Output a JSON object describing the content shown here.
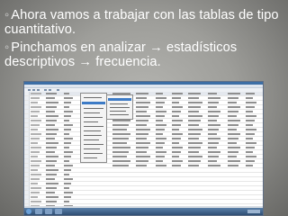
{
  "slide": {
    "bullets": [
      {
        "marker": "◦",
        "text": "Ahora vamos a trabajar con las tablas de tipo cuantitativo."
      },
      {
        "marker": "◦",
        "text": "Pinchamos en analizar → estadísticos descriptivos → frecuencia."
      }
    ]
  },
  "screenshot": {
    "menu": "analizar",
    "submenu": "estadísticos descriptivos",
    "selected_item": "frecuencia"
  },
  "colors": {
    "slide_background": "#9e9e9a",
    "text": "#ffffff",
    "accent": "#3d7bc6",
    "taskbar": "#2f4f74"
  }
}
